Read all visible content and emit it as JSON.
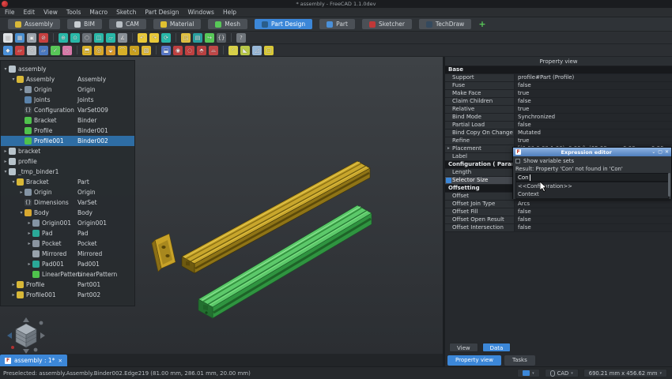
{
  "window": {
    "title": "* assembly - FreeCAD 1.1.0dev"
  },
  "menus": [
    "File",
    "Edit",
    "View",
    "Tools",
    "Macro",
    "Sketch",
    "Part Design",
    "Windows",
    "Help"
  ],
  "workbenches": [
    {
      "label": "Assembly",
      "c": "#d8b838",
      "cls": ""
    },
    {
      "label": "BIM",
      "c": "#c8cdd2",
      "cls": ""
    },
    {
      "label": "CAM",
      "c": "#b8bec4",
      "cls": ""
    },
    {
      "label": "Material",
      "c": "#e0c030",
      "cls": ""
    },
    {
      "label": "Mesh",
      "c": "#58c858",
      "cls": ""
    },
    {
      "label": "Part Design",
      "c": "#2a5d8a",
      "cls": "active"
    },
    {
      "label": "Part",
      "c": "#4a90d9",
      "cls": ""
    },
    {
      "label": "Sketcher",
      "c": "#c03838",
      "cls": ""
    },
    {
      "label": "TechDraw",
      "c": "#34495e",
      "cls": ""
    }
  ],
  "wb_add_label": "+",
  "toolbars": {
    "row2": [
      {
        "n": "new-document-icon",
        "c": "#dfe3e6",
        "g": "▤",
        "cls": ""
      },
      {
        "n": "open-document-icon",
        "c": "#4a8fd0",
        "g": "▦",
        "cls": ""
      },
      {
        "n": "save-document-icon",
        "c": "#9aa2ab",
        "g": "▣",
        "cls": ""
      },
      {
        "n": "abort-icon",
        "c": "#c84040",
        "g": "⊘",
        "cls": ""
      },
      {
        "n": "separator",
        "c": "",
        "g": "",
        "cls": "sep"
      },
      {
        "n": "fit-all-icon",
        "c": "#28b8a8",
        "g": "⊕",
        "cls": ""
      },
      {
        "n": "fit-selection-icon",
        "c": "#28b8a8",
        "g": "⊙",
        "cls": ""
      },
      {
        "n": "isometric-view-icon",
        "c": "#6a7077",
        "g": "⬡",
        "cls": ""
      },
      {
        "n": "draw-style-icon",
        "c": "#28b8a8",
        "g": "◫",
        "cls": ""
      },
      {
        "n": "view-front-icon",
        "c": "#28b8a8",
        "g": "▱",
        "cls": ""
      },
      {
        "n": "measure-icon",
        "c": "#8a9198",
        "g": "∡",
        "cls": ""
      },
      {
        "n": "separator",
        "c": "",
        "g": "",
        "cls": "sep"
      },
      {
        "n": "undo-icon",
        "c": "#e8c838",
        "g": "↶",
        "cls": ""
      },
      {
        "n": "redo-icon",
        "c": "#e8c838",
        "g": "↷",
        "cls": ""
      },
      {
        "n": "refresh-icon",
        "c": "#28b8a8",
        "g": "⟳",
        "cls": ""
      },
      {
        "n": "separator",
        "c": "",
        "g": "",
        "cls": "sep"
      },
      {
        "n": "std-part-icon",
        "c": "#e0c040",
        "g": "◳",
        "cls": ""
      },
      {
        "n": "std-group-icon",
        "c": "#28a0a0",
        "g": "▤",
        "cls": ""
      },
      {
        "n": "make-link-icon",
        "c": "#58c858",
        "g": "↪",
        "cls": ""
      },
      {
        "n": "varset-icon",
        "c": "#5a6066",
        "g": "{}",
        "cls": ""
      },
      {
        "n": "separator",
        "c": "",
        "g": "",
        "cls": "sep"
      },
      {
        "n": "whats-this-icon",
        "c": "#70767c",
        "g": "?",
        "cls": ""
      }
    ],
    "row3": [
      {
        "n": "create-body-icon",
        "c": "#4a90d9",
        "g": "◆",
        "cls": ""
      },
      {
        "n": "create-sketch-icon",
        "c": "#c84040",
        "g": "▱",
        "cls": ""
      },
      {
        "n": "edit-sketch-icon",
        "c": "#b8bec4",
        "g": "✎",
        "cls": ""
      },
      {
        "n": "map-sketch-icon",
        "c": "#4a78c0",
        "g": "▱",
        "cls": ""
      },
      {
        "n": "validate-sketch-icon",
        "c": "#58c858",
        "g": "✓",
        "cls": ""
      },
      {
        "n": "create-datum-icon",
        "c": "#d878a8",
        "g": "◇",
        "cls": ""
      },
      {
        "n": "separator",
        "c": "",
        "g": "",
        "cls": "sep"
      },
      {
        "n": "pad-icon",
        "c": "#d8b028",
        "g": "⬒",
        "cls": ""
      },
      {
        "n": "revolution-icon",
        "c": "#d8a828",
        "g": "◎",
        "cls": ""
      },
      {
        "n": "additive-loft-icon",
        "c": "#d89828",
        "g": "⬙",
        "cls": ""
      },
      {
        "n": "additive-pipe-icon",
        "c": "#d8b028",
        "g": "⌒",
        "cls": ""
      },
      {
        "n": "additive-helix-icon",
        "c": "#c8a020",
        "g": "∿",
        "cls": ""
      },
      {
        "n": "additive-box-icon",
        "c": "#e0b830",
        "g": "▧",
        "cls": ""
      },
      {
        "n": "separator",
        "c": "",
        "g": "",
        "cls": "sep"
      },
      {
        "n": "pocket-icon",
        "c": "#5878c8",
        "g": "⬓",
        "cls": ""
      },
      {
        "n": "hole-icon",
        "c": "#c04040",
        "g": "◉",
        "cls": ""
      },
      {
        "n": "groove-icon",
        "c": "#c04040",
        "g": "◌",
        "cls": ""
      },
      {
        "n": "subtractive-loft-icon",
        "c": "#b84040",
        "g": "⬘",
        "cls": ""
      },
      {
        "n": "subtractive-pipe-icon",
        "c": "#c04848",
        "g": "⌓",
        "cls": ""
      },
      {
        "n": "separator",
        "c": "",
        "g": "",
        "cls": "sep"
      },
      {
        "n": "fillet-icon",
        "c": "#d8d048",
        "g": "◜",
        "cls": ""
      },
      {
        "n": "chamfer-icon",
        "c": "#b8c848",
        "g": "◣",
        "cls": ""
      },
      {
        "n": "draft-icon",
        "c": "#98b8d8",
        "g": "◿",
        "cls": ""
      },
      {
        "n": "thickness-icon",
        "c": "#d8c838",
        "g": "▢",
        "cls": ""
      }
    ]
  },
  "tree": {
    "items": [
      {
        "pad": "2px",
        "exp": "▾",
        "c": "#b8c4cc",
        "g": "",
        "label": "assembly",
        "value": "",
        "sel": ""
      },
      {
        "pad": "12px",
        "exp": "▾",
        "c": "#d8b838",
        "g": "",
        "label": "Assembly",
        "value": "Assembly",
        "sel": ""
      },
      {
        "pad": "22px",
        "exp": "▸",
        "c": "#8494a4",
        "g": "",
        "label": "Origin",
        "value": "Origin",
        "sel": ""
      },
      {
        "pad": "22px",
        "exp": "",
        "c": "#5a82aa",
        "g": "",
        "label": "Joints",
        "value": "Joints",
        "sel": ""
      },
      {
        "pad": "22px",
        "exp": "",
        "c": "#3a3f44",
        "g": "{}",
        "label": "Configuration",
        "value": "VarSet009",
        "sel": ""
      },
      {
        "pad": "22px",
        "exp": "",
        "c": "#4fc24c",
        "g": "",
        "label": "Bracket",
        "value": "Binder",
        "sel": ""
      },
      {
        "pad": "22px",
        "exp": "",
        "c": "#4fc24c",
        "g": "",
        "label": "Profile",
        "value": "Binder001",
        "sel": ""
      },
      {
        "pad": "22px",
        "exp": "",
        "c": "#4fc24c",
        "g": "",
        "label": "Profile001",
        "value": "Binder002",
        "sel": "sel"
      },
      {
        "pad": "2px",
        "exp": "▸",
        "c": "#b8c4cc",
        "g": "",
        "label": "bracket",
        "value": "",
        "sel": ""
      },
      {
        "pad": "2px",
        "exp": "▸",
        "c": "#b8c4cc",
        "g": "",
        "label": "profile",
        "value": "",
        "sel": ""
      },
      {
        "pad": "2px",
        "exp": "▾",
        "c": "#b8c4cc",
        "g": "",
        "label": "_tmp_binder1",
        "value": "",
        "sel": ""
      },
      {
        "pad": "12px",
        "exp": "▾",
        "c": "#d8b838",
        "g": "",
        "label": "Bracket",
        "value": "Part",
        "sel": ""
      },
      {
        "pad": "22px",
        "exp": "▸",
        "c": "#8494a4",
        "g": "",
        "label": "Origin",
        "value": "Origin",
        "sel": ""
      },
      {
        "pad": "22px",
        "exp": "",
        "c": "#3a3f44",
        "g": "{}",
        "label": "Dimensions",
        "value": "VarSet",
        "sel": ""
      },
      {
        "pad": "22px",
        "exp": "▾",
        "c": "#d8a830",
        "g": "",
        "label": "Body",
        "value": "Body",
        "sel": ""
      },
      {
        "pad": "32px",
        "exp": "▸",
        "c": "#8494a4",
        "g": "",
        "label": "Origin001",
        "value": "Origin001",
        "sel": ""
      },
      {
        "pad": "32px",
        "exp": "▸",
        "c": "#2aa898",
        "g": "",
        "label": "Pad",
        "value": "Pad",
        "sel": ""
      },
      {
        "pad": "32px",
        "exp": "▸",
        "c": "#8a94a0",
        "g": "",
        "label": "Pocket",
        "value": "Pocket",
        "sel": ""
      },
      {
        "pad": "32px",
        "exp": "",
        "c": "#98a2ac",
        "g": "",
        "label": "Mirrored",
        "value": "Mirrored",
        "sel": ""
      },
      {
        "pad": "32px",
        "exp": "▸",
        "c": "#2aa898",
        "g": "",
        "label": "Pad001",
        "value": "Pad001",
        "sel": ""
      },
      {
        "pad": "32px",
        "exp": "",
        "c": "#4fc24c",
        "g": "",
        "label": "LinearPattern",
        "value": "LinearPattern",
        "sel": ""
      },
      {
        "pad": "12px",
        "exp": "▸",
        "c": "#d8b838",
        "g": "",
        "label": "Profile",
        "value": "Part001",
        "sel": ""
      },
      {
        "pad": "12px",
        "exp": "▸",
        "c": "#d8b838",
        "g": "",
        "label": "Profile001",
        "value": "Part002",
        "sel": ""
      }
    ]
  },
  "viewport": {
    "tab_label": "assembly : 1*",
    "tab_close": "✕"
  },
  "property_panel": {
    "title": "Property view",
    "rows": [
      {
        "cls": "group",
        "arrow": "",
        "name": "Base",
        "value": ""
      },
      {
        "cls": "",
        "arrow": "",
        "name": "Support",
        "value": "profile#Part (Profile)"
      },
      {
        "cls": "",
        "arrow": "",
        "name": "Fuse",
        "value": "false"
      },
      {
        "cls": "",
        "arrow": "",
        "name": "Make Face",
        "value": "true"
      },
      {
        "cls": "",
        "arrow": "",
        "name": "Claim Children",
        "value": "false"
      },
      {
        "cls": "",
        "arrow": "",
        "name": "Relative",
        "value": "true"
      },
      {
        "cls": "",
        "arrow": "",
        "name": "Bind Mode",
        "value": "Synchronized"
      },
      {
        "cls": "",
        "arrow": "",
        "name": "Partial Load",
        "value": "false"
      },
      {
        "cls": "",
        "arrow": "",
        "name": "Bind Copy On Change",
        "value": "Mutated"
      },
      {
        "cls": "",
        "arrow": "",
        "name": "Refine",
        "value": "true"
      },
      {
        "cls": "",
        "arrow": "▸",
        "name": "Placement",
        "value": "[(0.00 0.00 1.00); 0.00 °; (65.00 mm, 0.00 mm, 0.00 mm)]"
      },
      {
        "cls": "",
        "arrow": "",
        "name": "Label",
        "value": ""
      },
      {
        "cls": "group",
        "arrow": "",
        "name": "Configuration ( Params)",
        "value": ""
      },
      {
        "cls": "",
        "arrow": "",
        "name": "Length",
        "value": ""
      },
      {
        "cls": "sel",
        "arrow": "",
        "name": "Selector Size",
        "value": ""
      },
      {
        "cls": "group",
        "arrow": "",
        "name": "Offsetting",
        "value": ""
      },
      {
        "cls": "",
        "arrow": "",
        "name": "Offset",
        "value": ""
      },
      {
        "cls": "",
        "arrow": "",
        "name": "Offset Join Type",
        "value": "Arcs"
      },
      {
        "cls": "",
        "arrow": "",
        "name": "Offset Fill",
        "value": "false"
      },
      {
        "cls": "",
        "arrow": "",
        "name": "Offset Open Result",
        "value": "false"
      },
      {
        "cls": "",
        "arrow": "",
        "name": "Offset Intersection",
        "value": "false"
      }
    ],
    "view_btn": "View",
    "data_btn": "Data",
    "tab_property": "Property view",
    "tab_tasks": "Tasks"
  },
  "dialog": {
    "title": "Expression editor",
    "icon_letter": "F",
    "checkbox_label": "Show variable sets",
    "result_text": "Result: Property 'Con' not found in 'Con'",
    "input_value": "Con",
    "suggestions": [
      "<<Configuration>>",
      "Context"
    ],
    "btn_min": "⌄",
    "btn_max": "▢",
    "btn_close": "✕"
  },
  "statusbar": {
    "left": "Preselected: assembly.Assembly.Binder002.Edge219 (81.00 mm, 286.01 mm, 20.00 mm)",
    "mouse_mode": "CAD",
    "dimensions": "690.21 mm x 456.62 mm",
    "caret": "▾"
  },
  "colors": {
    "accent": "#3c87d8",
    "selection": "#2e6da4",
    "beam_yellow": "#c8a62c",
    "beam_green": "#5cc96a"
  }
}
